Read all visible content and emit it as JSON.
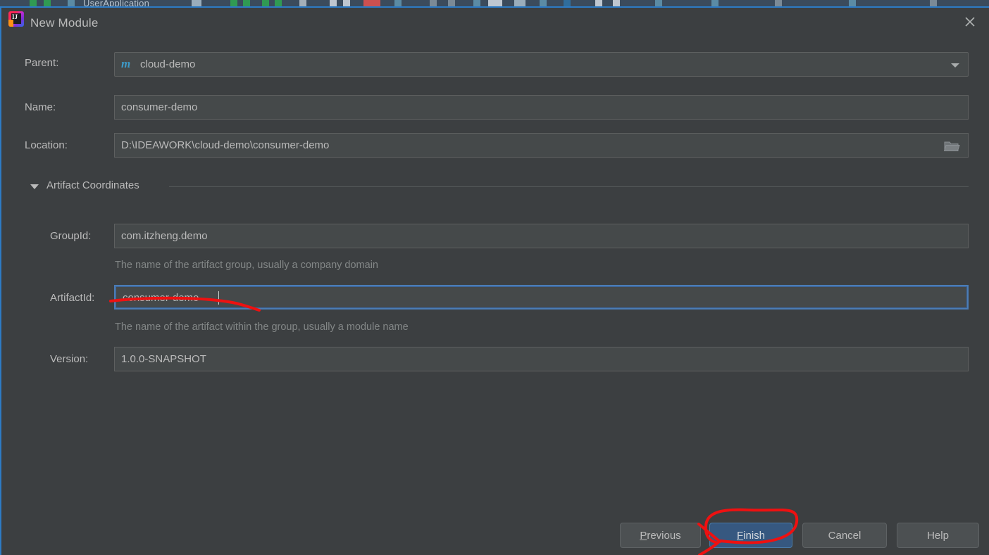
{
  "background_ide": {
    "visible_text": "UserApplication"
  },
  "dialog": {
    "title": "New Module",
    "logo_icon": "intellij-idea-logo",
    "close_icon": "close-icon"
  },
  "form": {
    "parent": {
      "label": "Parent:",
      "value": "cloud-demo",
      "icon": "maven-m-icon",
      "dropdown_icon": "chevron-down-icon"
    },
    "name": {
      "label": "Name:",
      "value": "consumer-demo"
    },
    "location": {
      "label": "Location:",
      "value": "D:\\IDEAWORK\\cloud-demo\\consumer-demo",
      "browse_icon": "folder-icon"
    }
  },
  "artifact_section": {
    "label": "Artifact Coordinates",
    "expanded": true,
    "collapse_icon": "triangle-down-icon",
    "group_id": {
      "label": "GroupId:",
      "value": "com.itzheng.demo",
      "hint": "The name of the artifact group, usually a company domain"
    },
    "artifact_id": {
      "label": "ArtifactId:",
      "value": "consumer-demo",
      "hint": "The name of the artifact within the group, usually a module name",
      "focused": true
    },
    "version": {
      "label": "Version:",
      "value": "1.0.0-SNAPSHOT"
    }
  },
  "buttons": {
    "previous": {
      "label": "Previous",
      "mnemonic": "P"
    },
    "finish": {
      "label": "Finish",
      "mnemonic": "F",
      "primary": true
    },
    "cancel": {
      "label": "Cancel"
    },
    "help": {
      "label": "Help"
    }
  },
  "colors": {
    "dialog_background": "#3c3f41",
    "field_background": "#45494a",
    "text": "#bbbbbb",
    "hint_text": "#838787",
    "focus_border": "#4b7cb5",
    "primary_button": "#365880",
    "maven_icon": "#3d9ac7",
    "annotation": "#ee1111",
    "dialog_border": "#2d7bc4"
  },
  "annotations": {
    "artifact_id_underline": "red-hand-drawn-underline",
    "finish_circle": "red-hand-drawn-circle"
  }
}
